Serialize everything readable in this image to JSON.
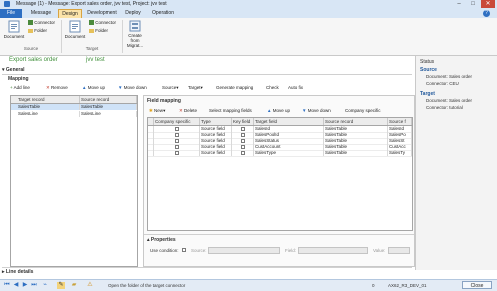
{
  "window": {
    "title": "Message (1) - Message: Export sales order, jvv test, Project: jvv test",
    "buttons": [
      "–",
      "□",
      "✕"
    ]
  },
  "tabs": [
    {
      "label": "File"
    },
    {
      "label": "Message"
    },
    {
      "label": "Design"
    },
    {
      "label": "Development"
    },
    {
      "label": "Deploy"
    },
    {
      "label": "Operation"
    }
  ],
  "ribbon": {
    "source_group": {
      "document": "Document",
      "connector": "Connector",
      "folder": "Folder",
      "label": "Source"
    },
    "target_group": {
      "document": "Document",
      "connector": "Connector",
      "folder": "Folder",
      "label": "Target"
    },
    "create": {
      "line1": "Create",
      "line2": "from",
      "line3": "Migrat..."
    }
  },
  "breadcrumb": {
    "left": "Export sales order",
    "right": "jvv test"
  },
  "sections": {
    "general": "General",
    "mapping": "Mapping",
    "line_details": "Line details",
    "field_mapping": "Field mapping",
    "properties": "Properties"
  },
  "record_toolbar": {
    "add_line": "Add line",
    "remove": "Remove",
    "move_up": "Move up",
    "move_down": "Move down",
    "source": "Source",
    "target": "Target",
    "generate_mapping": "Generate mapping",
    "check": "Check",
    "auto_fix": "Auto fix"
  },
  "record_grid": {
    "headers": [
      "Target record",
      "Source record"
    ],
    "rows": [
      [
        "SalesTable",
        "SalesTable"
      ],
      [
        "SalesLine",
        "SalesLine"
      ]
    ]
  },
  "field_toolbar": {
    "new": "New",
    "delete": "Delete",
    "select_mapping_fields": "Select mapping fields",
    "move_up": "Move up",
    "move_down": "Move down",
    "company_specific": "Company specific"
  },
  "field_grid": {
    "headers": [
      "Company specific",
      "Type",
      "Key field",
      "Target field",
      "Source record",
      "Source f"
    ],
    "rows": [
      {
        "type": "Source field",
        "target": "SalesId",
        "source_record": "SalesTable",
        "source_field": "SalesId"
      },
      {
        "type": "Source field",
        "target": "SalesPoolId",
        "source_record": "SalesTable",
        "source_field": "SalesPo"
      },
      {
        "type": "Source field",
        "target": "SalesStatus",
        "source_record": "SalesTable",
        "source_field": "SalesSt"
      },
      {
        "type": "Source field",
        "target": "CustAccount",
        "source_record": "SalesTable",
        "source_field": "CustAcc"
      },
      {
        "type": "Source field",
        "target": "SalesType",
        "source_record": "SalesTable",
        "source_field": "SalesTy"
      }
    ]
  },
  "properties": {
    "use_condition": "Use condition:",
    "source": "Source:",
    "field": "Field:",
    "value": "Value:"
  },
  "status_pane": {
    "title": "Status",
    "source_header": "Source",
    "source_document": "Document:  Sales order",
    "source_connector": "Connector:  CEU",
    "target_header": "Target",
    "target_document": "Document:  Sales order",
    "target_connector": "Connector:  tutorial"
  },
  "bottom_bar": {
    "status_text": "Open the folder of the target connector",
    "badge": "0",
    "server": "AX62_R3_DEV_01",
    "close": "Close"
  }
}
